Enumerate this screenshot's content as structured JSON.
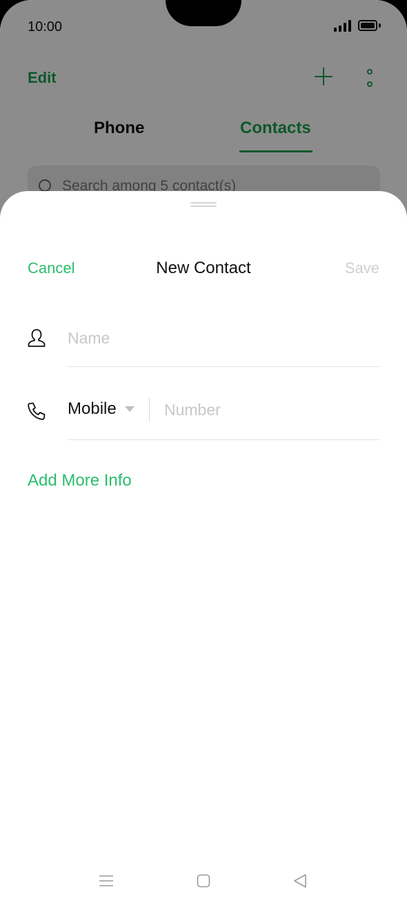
{
  "status_bar": {
    "time": "10:00",
    "signal_icon": "signal-icon",
    "battery_icon": "battery-icon"
  },
  "background_app": {
    "edit_label": "Edit",
    "add_icon": "plus-icon",
    "more_icon": "more-vertical-icon",
    "tabs": [
      {
        "label": "Phone"
      },
      {
        "label": "Contacts"
      }
    ],
    "search": {
      "placeholder": "Search among 5 contact(s)",
      "icon": "search-icon"
    }
  },
  "sheet": {
    "cancel_label": "Cancel",
    "title": "New Contact",
    "save_label": "Save",
    "name_field": {
      "icon": "person-icon",
      "placeholder": "Name",
      "value": ""
    },
    "phone_field": {
      "icon": "phone-icon",
      "type_label": "Mobile",
      "placeholder": "Number",
      "value": ""
    },
    "add_more_label": "Add More Info"
  },
  "nav_bar": {
    "menu_icon": "menu-icon",
    "home_icon": "home-icon",
    "back_icon": "back-icon"
  },
  "colors": {
    "accent": "#2bbd6c",
    "accent_dark": "#1aa04f",
    "disabled": "#cfcfcf"
  }
}
